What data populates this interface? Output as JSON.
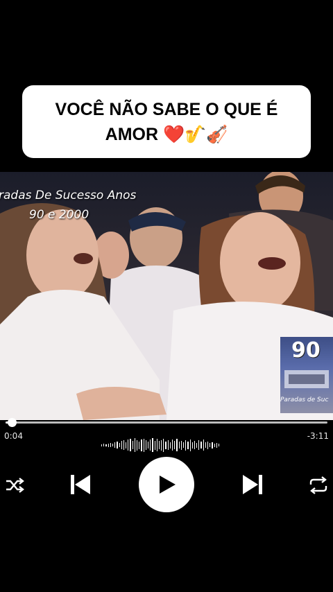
{
  "caption": {
    "line1": "VOCÊ NÃO SABE O QUE É",
    "line2": "AMOR ❤️🎷🎻"
  },
  "video": {
    "overlay_line1": "radas De Sucesso Anos",
    "overlay_line2": "90 e 2000",
    "logo_number": "90",
    "logo_text": "Paradas de Suc"
  },
  "player": {
    "elapsed": "0:04",
    "remaining": "-3:11",
    "progress_fraction": 0.02,
    "icons": [
      "shuffle-icon",
      "previous-icon",
      "play-icon",
      "next-icon",
      "repeat-icon"
    ]
  }
}
